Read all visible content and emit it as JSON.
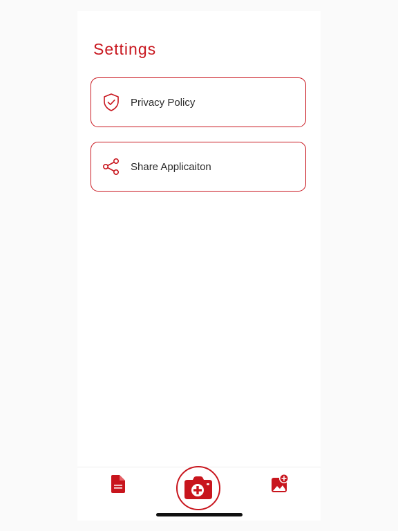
{
  "page": {
    "title": "Settings"
  },
  "settings_items": [
    {
      "label": "Privacy Policy",
      "icon": "shield-check-icon"
    },
    {
      "label": "Share Applicaiton",
      "icon": "share-icon"
    }
  ],
  "bottom_nav": {
    "left_icon": "document-icon",
    "center_icon": "camera-add-icon",
    "right_icon": "image-add-icon"
  },
  "colors": {
    "accent": "#c8151d",
    "text": "#2a2a2a",
    "background": "#ffffff"
  }
}
